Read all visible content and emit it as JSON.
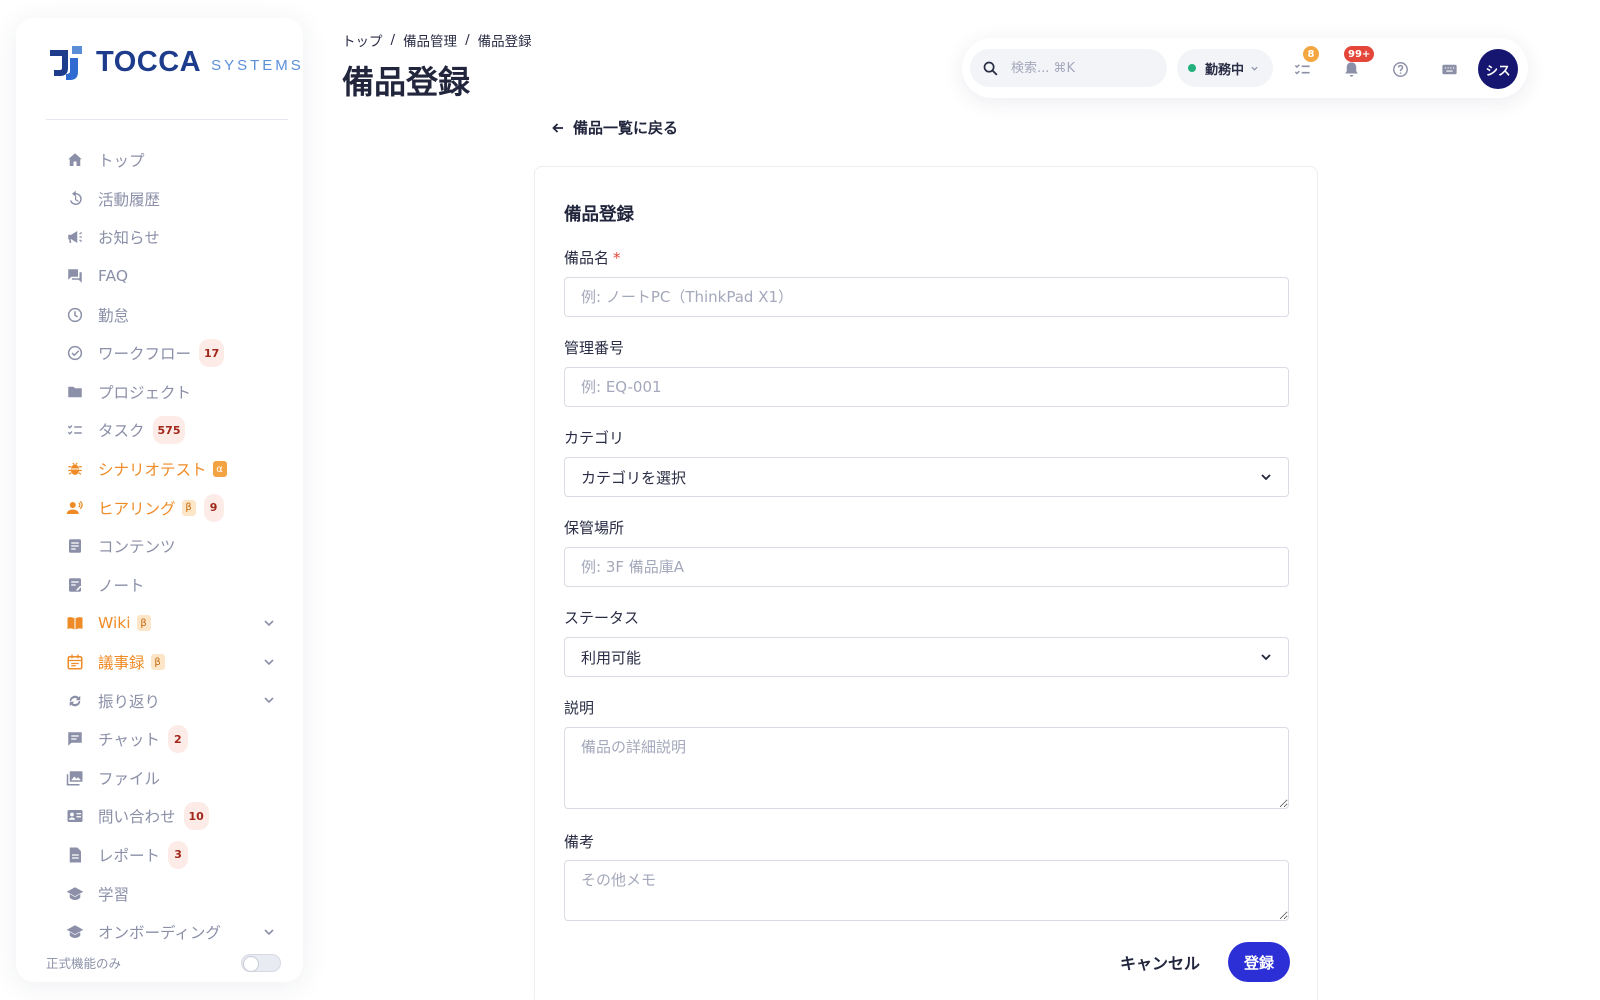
{
  "brand": {
    "name": "TOCCA",
    "sub": "SYSTEMS"
  },
  "sidebar": {
    "items": [
      {
        "label": "トップ",
        "icon": "home-icon"
      },
      {
        "label": "活動履歴",
        "icon": "history-icon"
      },
      {
        "label": "お知らせ",
        "icon": "megaphone-icon"
      },
      {
        "label": "FAQ",
        "icon": "forum-icon"
      },
      {
        "label": "勤怠",
        "icon": "clock-icon"
      },
      {
        "label": "ワークフロー",
        "icon": "check-circle-icon",
        "count": "17"
      },
      {
        "label": "プロジェクト",
        "icon": "folder-icon"
      },
      {
        "label": "タスク",
        "icon": "checklist-icon",
        "count": "575"
      },
      {
        "label": "シナリオテスト",
        "icon": "bug-icon",
        "tag": "α"
      },
      {
        "label": "ヒアリング",
        "icon": "hearing-icon",
        "tag": "β",
        "count": "9"
      },
      {
        "label": "コンテンツ",
        "icon": "article-icon"
      },
      {
        "label": "ノート",
        "icon": "note-icon"
      },
      {
        "label": "Wiki",
        "icon": "book-icon",
        "tag": "β"
      },
      {
        "label": "議事録",
        "icon": "calendar-icon",
        "tag": "β"
      },
      {
        "label": "振り返り",
        "icon": "sync-icon"
      },
      {
        "label": "チャット",
        "icon": "chat-icon",
        "count": "2"
      },
      {
        "label": "ファイル",
        "icon": "images-icon"
      },
      {
        "label": "問い合わせ",
        "icon": "contact-card-icon",
        "count": "10"
      },
      {
        "label": "レポート",
        "icon": "report-icon",
        "count": "3"
      },
      {
        "label": "学習",
        "icon": "school-icon"
      },
      {
        "label": "オンボーディング",
        "icon": "school-icon"
      }
    ],
    "footer_label": "正式機能のみ"
  },
  "breadcrumb": [
    "トップ",
    "備品管理",
    "備品登録"
  ],
  "page_title": "備品登録",
  "topbar": {
    "search_placeholder": "検索... ⌘K",
    "status_label": "勤務中",
    "tasks_badge": "8",
    "notifications_badge": "99+",
    "avatar_label": "シス"
  },
  "form": {
    "back_label": "備品一覧に戻る",
    "title": "備品登録",
    "name_label": "備品名",
    "required_mark": "*",
    "name_placeholder": "例: ノートPC（ThinkPad X1）",
    "code_label": "管理番号",
    "code_placeholder": "例: EQ-001",
    "category_label": "カテゴリ",
    "category_value": "カテゴリを選択",
    "location_label": "保管場所",
    "location_placeholder": "例: 3F 備品庫A",
    "status_label": "ステータス",
    "status_value": "利用可能",
    "description_label": "説明",
    "description_placeholder": "備品の詳細説明",
    "remarks_label": "備考",
    "remarks_placeholder": "その他メモ",
    "cancel_label": "キャンセル",
    "submit_label": "登録"
  },
  "colors": {
    "accent": "#2c2fd6",
    "brand": "#1d3c8b",
    "beta_orange": "#ef8b26",
    "count_bg": "#fdebe8",
    "status_green": "#22b07d"
  }
}
